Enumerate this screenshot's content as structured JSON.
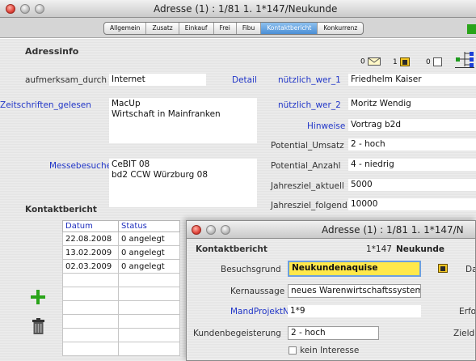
{
  "window": {
    "title": "Adresse (1) : 1/81 1.  1*147/Neukunde"
  },
  "tabs": [
    "Allgemein",
    "Zusatz",
    "Einkauf",
    "Frei",
    "Fibu",
    "Kontaktbericht",
    "Konkurrenz"
  ],
  "active_tab": "Kontaktbericht",
  "section_title": "Adressinfo",
  "counters": {
    "mail": "0",
    "calendar": "1",
    "notes": "0"
  },
  "left": {
    "aufmerksam_label": "aufmerksam_durch",
    "aufmerksam_value": "Internet",
    "detail_link": "Detail",
    "zeitschriften_label": "Zeitschriften_gelesen",
    "zeitschriften_value": "MacUp\nWirtschaft in Mainfranken",
    "messebesuche_label": "Messebesuche",
    "messebesuche_value": "CeBIT 08\nbd2 CCW Würzburg 08"
  },
  "right": {
    "nuetzlich1_label": "nützlich_wer_1",
    "nuetzlich1_value": "Friedhelm Kaiser",
    "nuetzlich2_label": "nützlich_wer_2",
    "nuetzlich2_value": "Moritz Wendig",
    "hinweise_label": "Hinweise",
    "hinweise_value": "Vortrag b2d",
    "potential_umsatz_label": "Potential_Umsatz",
    "potential_umsatz_value": "2 - hoch",
    "potential_anzahl_label": "Potential_Anzahl",
    "potential_anzahl_value": "4 - niedrig",
    "jahresziel_aktuell_label": "Jahresziel_aktuell",
    "jahresziel_aktuell_value": "5000",
    "jahresziel_folgend_label": "Jahresziel_folgend",
    "jahresziel_folgend_value": "10000"
  },
  "kontaktbericht": {
    "title": "Kontaktbericht",
    "columns": [
      "Datum",
      "Status"
    ],
    "rows": [
      {
        "datum": "22.08.2008",
        "status": "0 angelegt"
      },
      {
        "datum": "13.02.2009",
        "status": "0 angelegt"
      },
      {
        "datum": "02.03.2009",
        "status": "0 angelegt"
      }
    ]
  },
  "subwindow": {
    "title": "Adresse (1) : 1/81 1.  1*147/N",
    "heading": "Kontaktbericht",
    "customer_number": "1*147",
    "customer_type": "Neukunde",
    "besuchsgrund_label": "Besuchsgrund",
    "besuchsgrund_value": "Neukundenaquise",
    "da_label": "Da",
    "kernaussage_label": "Kernaussage",
    "kernaussage_value": "neues Warenwirtschaftssystem",
    "mandprojekt_label": "MandProjektNr",
    "mandprojekt_value": "1*9",
    "erfo_label": "Erfo",
    "kundenbegeisterung_label": "Kundenbegeisterung",
    "kundenbegeisterung_value": "2 - hoch",
    "zield_label": "Zield",
    "kein_interesse_label": "kein Interesse"
  },
  "colors": {
    "link_blue": "#2136c8",
    "active_tab": "#4b8fd6",
    "highlight_yellow": "#ffe84a",
    "add_green": "#2aa41a"
  },
  "icons": [
    "close-icon",
    "minimize-icon",
    "zoom-icon",
    "mail-icon",
    "calendar-icon",
    "note-icon",
    "org-chart-icon",
    "add-icon",
    "trash-icon",
    "calendar-small-icon"
  ]
}
